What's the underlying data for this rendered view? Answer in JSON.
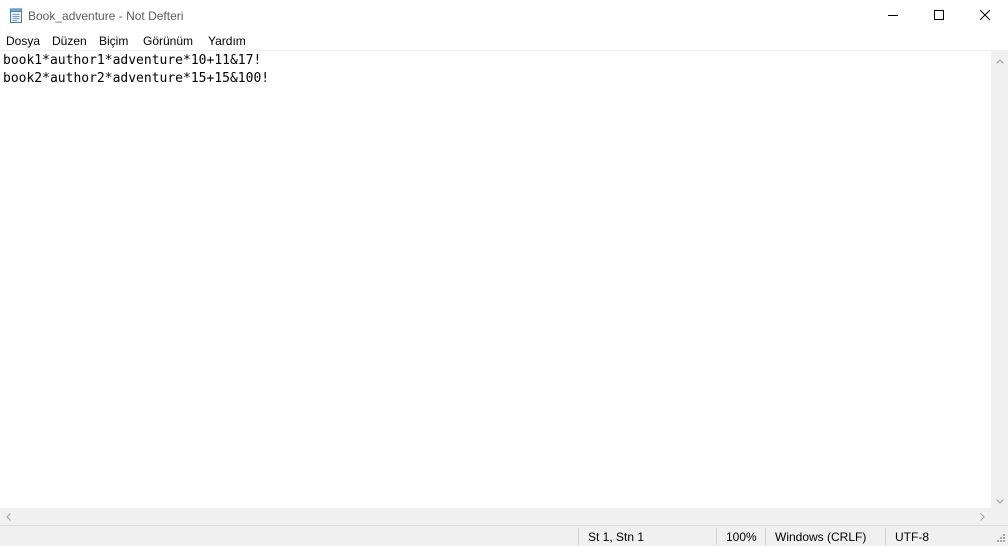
{
  "window": {
    "title": "Book_adventure - Not Defteri"
  },
  "icons": {
    "app": "notepad-icon",
    "minimize": "minimize-icon",
    "maximize": "maximize-icon",
    "close": "close-icon"
  },
  "menu": {
    "items": [
      {
        "label": "Dosya"
      },
      {
        "label": "Düzen"
      },
      {
        "label": "Biçim"
      },
      {
        "label": "Görünüm"
      },
      {
        "label": "Yardım"
      }
    ]
  },
  "editor": {
    "lines": [
      "book1*author1*adventure*10+11&17!",
      "book2*author2*adventure*15+15&100!"
    ]
  },
  "status": {
    "position": "St 1, Stn 1",
    "zoom": "100%",
    "line_ending": "Windows (CRLF)",
    "encoding": "UTF-8"
  },
  "colors": {
    "chrome": "#f0f0f0",
    "background": "#ffffff",
    "text": "#000000"
  }
}
